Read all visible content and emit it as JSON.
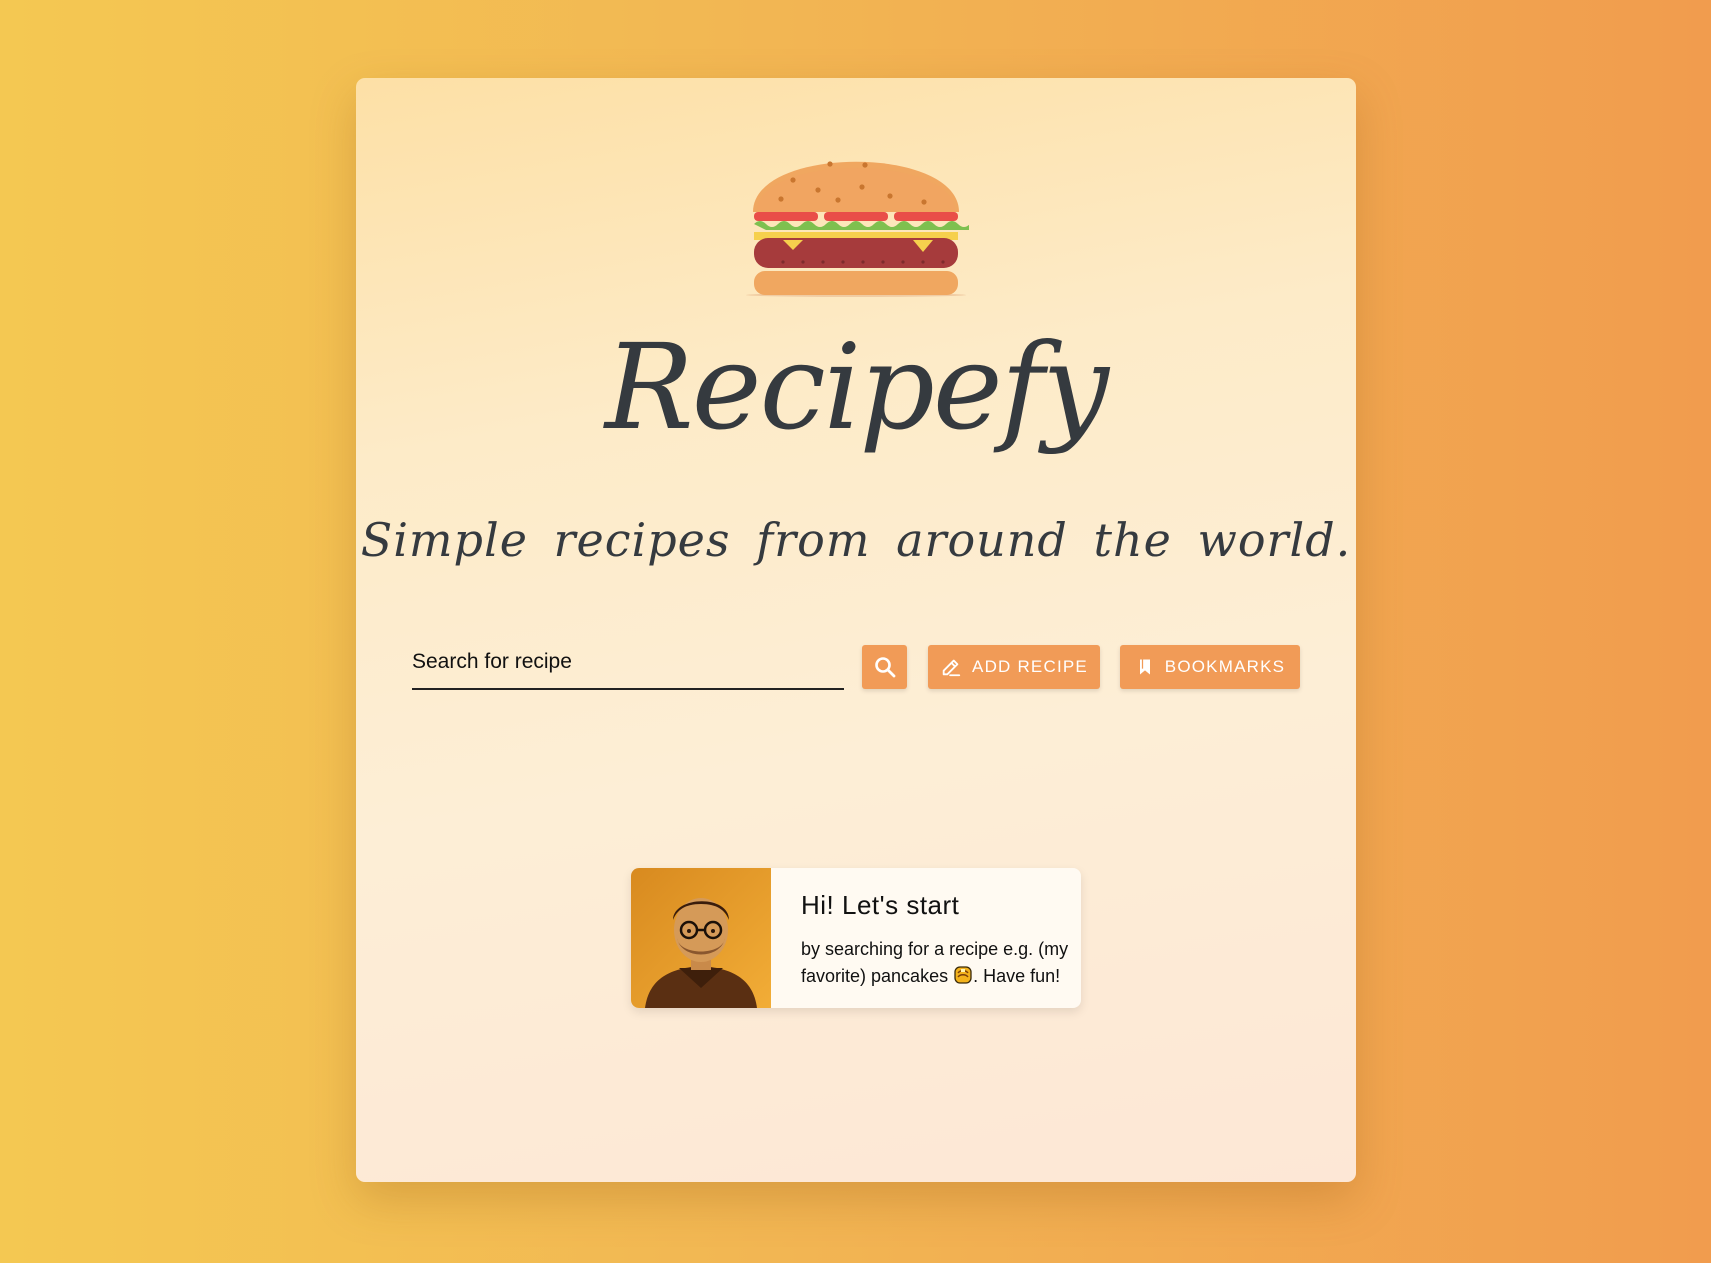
{
  "app": {
    "brand": "Recipefy",
    "tagline": "Simple recipes from around the world.",
    "logo_icon": "burger-icon"
  },
  "search": {
    "placeholder": "Search for recipe",
    "value": "",
    "button_icon": "search-icon"
  },
  "actions": {
    "add_recipe_label": "ADD RECIPE",
    "add_recipe_icon": "pencil-icon",
    "bookmarks_label": "BOOKMARKS",
    "bookmarks_icon": "bookmark-icon"
  },
  "welcome": {
    "title": "Hi! Let's start",
    "text_before_emoji": "by searching for a recipe e.g. (my favorite) pancakes ",
    "emoji": "pancakes-icon",
    "text_after_emoji": ". Have fun!"
  },
  "colors": {
    "accent": "#f19b57",
    "text_dark": "#353a3f",
    "background_start": "#f4c852",
    "background_end": "#f19c4e"
  }
}
